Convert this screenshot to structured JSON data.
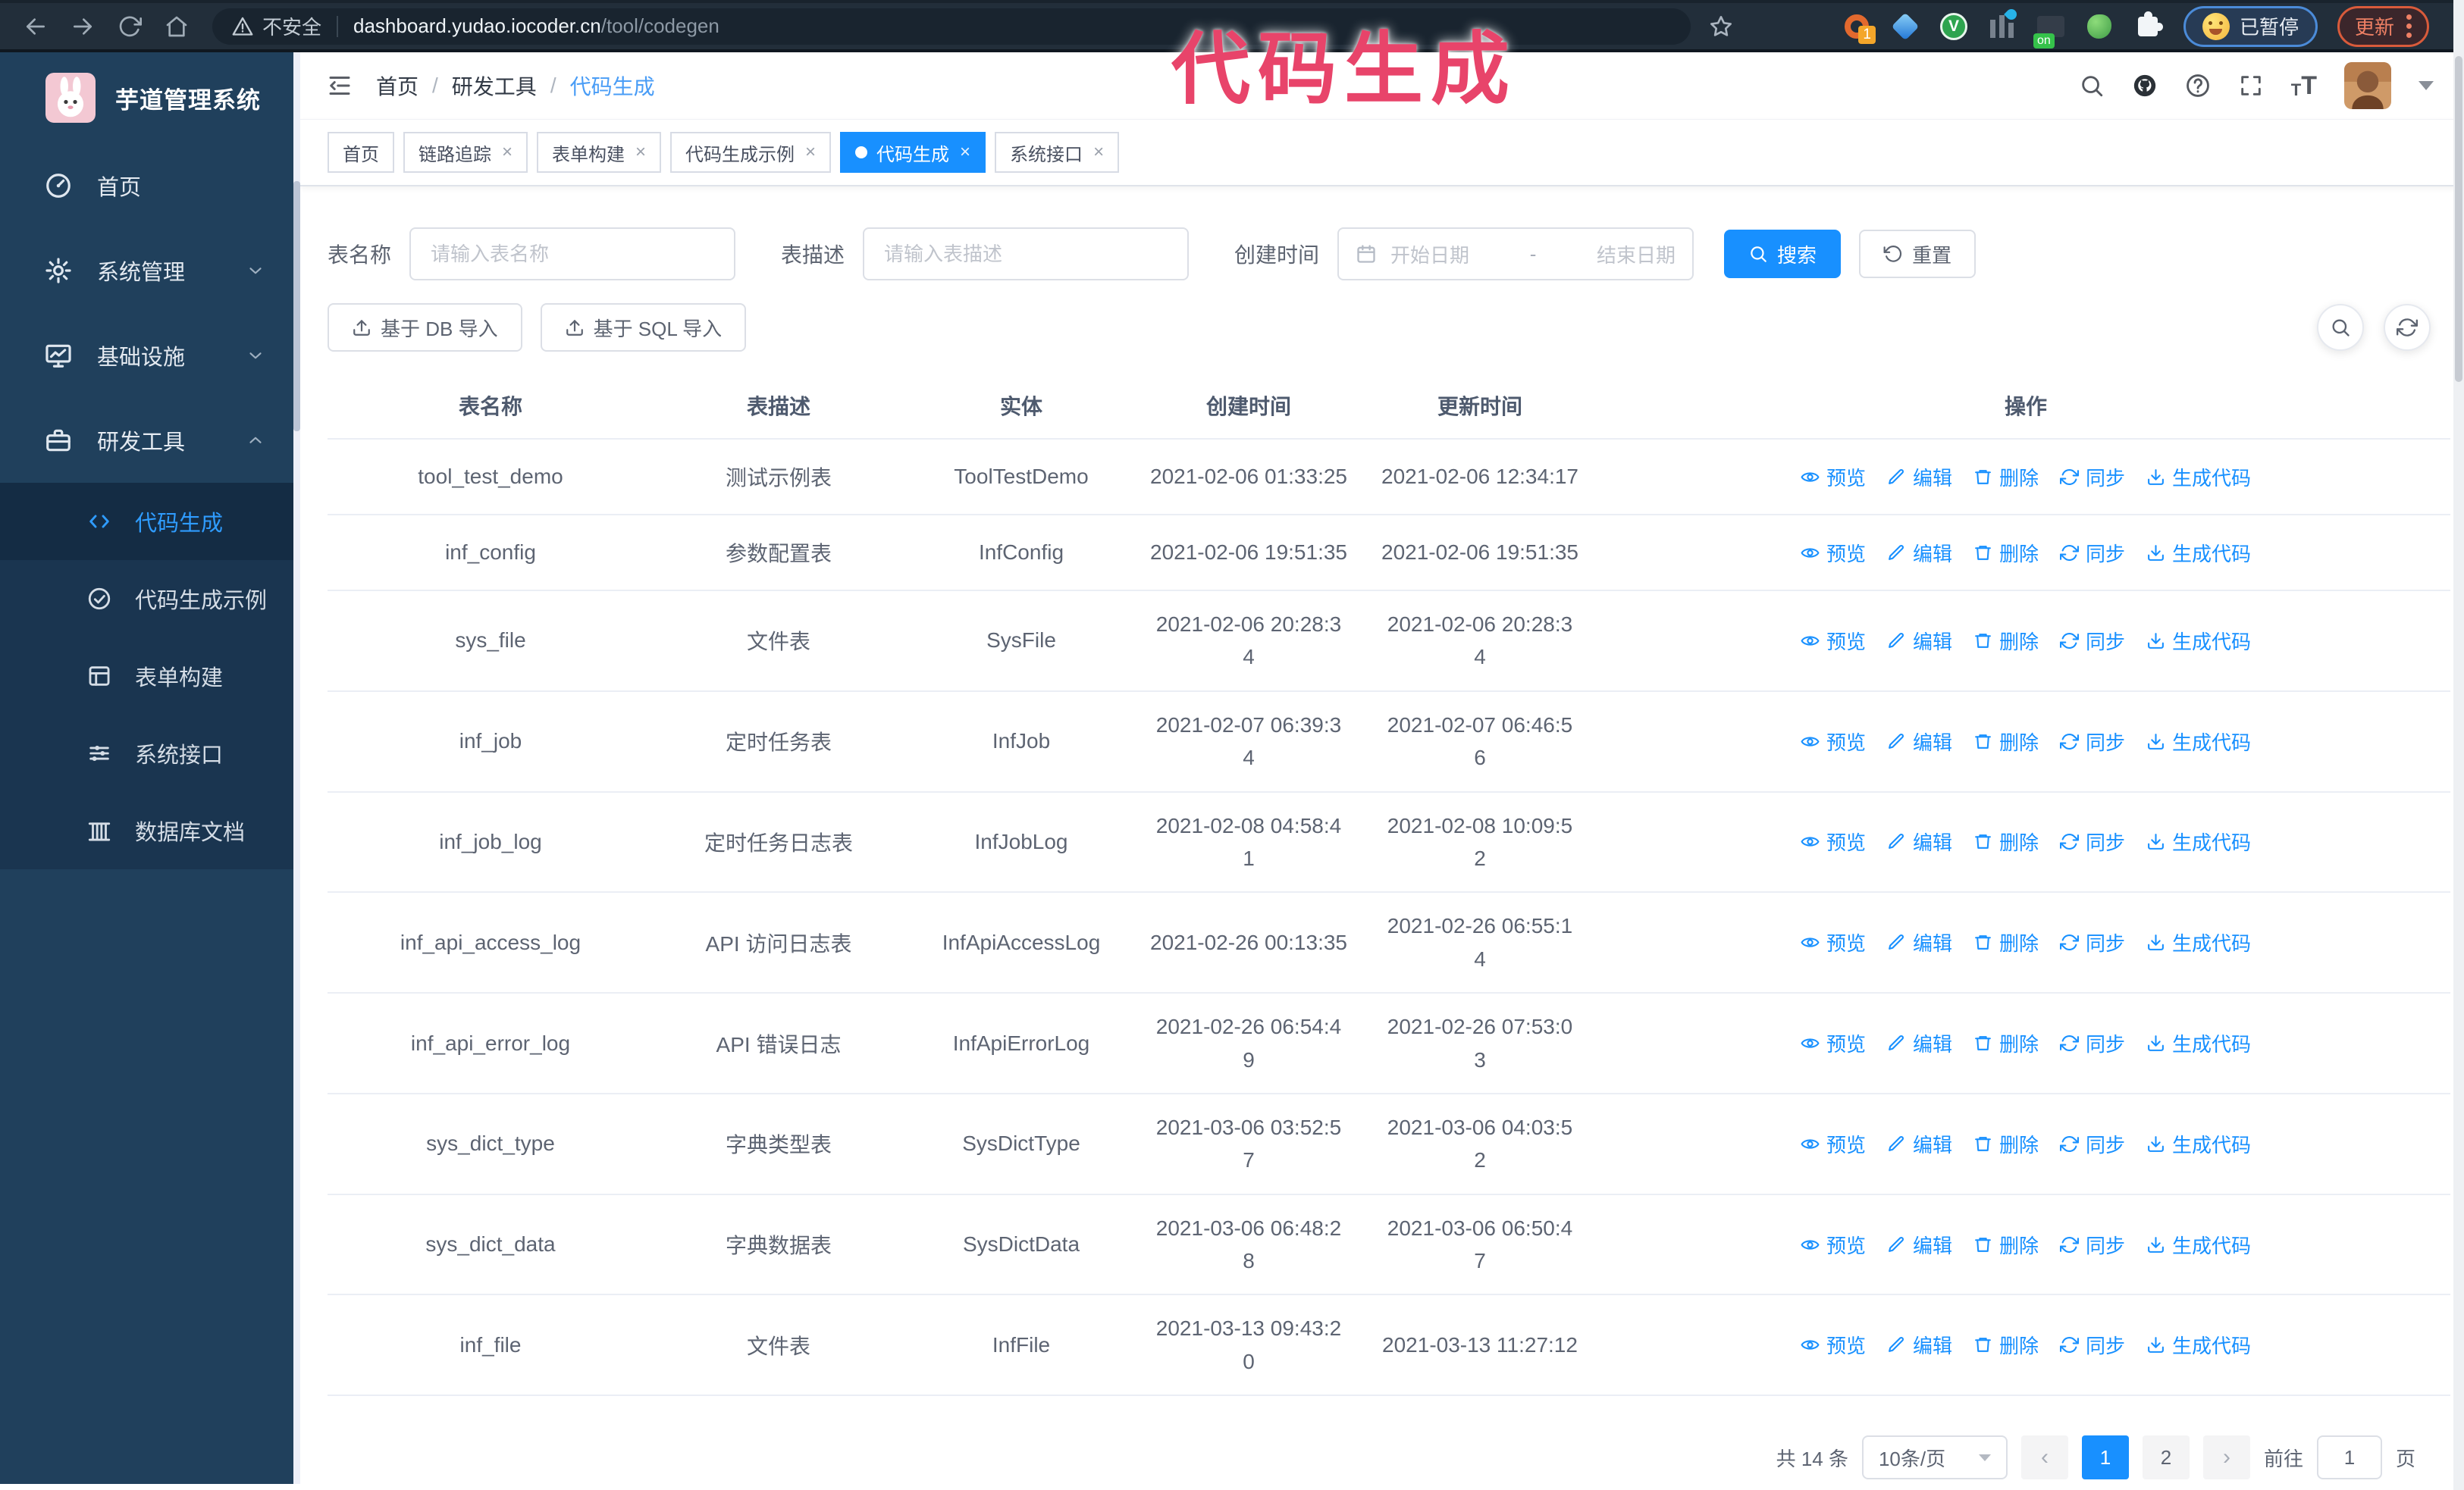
{
  "colors": {
    "primary": "#1890ff",
    "sidebar_bg": "#20405c",
    "submenu_bg": "#1a3550",
    "annotation": "#e8446a"
  },
  "annotation": {
    "text": "代码生成"
  },
  "browser": {
    "security_label": "不安全",
    "url_host": "dashboard.yudao.iocoder.cn",
    "url_path": "/tool/codegen",
    "ext_badge": "1",
    "ext_v_label": "V",
    "ext_on_badge": "on",
    "paused_label": "已暂停",
    "update_label": "更新"
  },
  "sidebar": {
    "title": "芋道管理系统",
    "items": [
      {
        "label": "首页"
      },
      {
        "label": "系统管理"
      },
      {
        "label": "基础设施"
      },
      {
        "label": "研发工具"
      }
    ],
    "dev_children": [
      {
        "label": "代码生成"
      },
      {
        "label": "代码生成示例"
      },
      {
        "label": "表单构建"
      },
      {
        "label": "系统接口"
      },
      {
        "label": "数据库文档"
      }
    ]
  },
  "topbar": {
    "breadcrumb": [
      "首页",
      "研发工具",
      "代码生成"
    ],
    "separator": "/"
  },
  "tabs": [
    {
      "label": "首页"
    },
    {
      "label": "链路追踪"
    },
    {
      "label": "表单构建"
    },
    {
      "label": "代码生成示例"
    },
    {
      "label": "代码生成"
    },
    {
      "label": "系统接口"
    }
  ],
  "ui": {
    "close_glyph": "×",
    "prev_glyph": "‹",
    "next_glyph": "›"
  },
  "search": {
    "name_label": "表名称",
    "name_placeholder": "请输入表名称",
    "desc_label": "表描述",
    "desc_placeholder": "请输入表描述",
    "time_label": "创建时间",
    "start_placeholder": "开始日期",
    "range_separator": "-",
    "end_placeholder": "结束日期",
    "search_label": "搜索",
    "reset_label": "重置"
  },
  "toolbar": {
    "db_import_label": "基于 DB 导入",
    "sql_import_label": "基于 SQL 导入"
  },
  "table": {
    "columns": [
      "表名称",
      "表描述",
      "实体",
      "创建时间",
      "更新时间",
      "操作"
    ],
    "actions": [
      "预览",
      "编辑",
      "删除",
      "同步",
      "生成代码"
    ],
    "rows": [
      {
        "name": "tool_test_demo",
        "desc": "测试示例表",
        "entity": "ToolTestDemo",
        "created": "2021-02-06 01:33:25",
        "updated": "2021-02-06 12:34:17"
      },
      {
        "name": "inf_config",
        "desc": "参数配置表",
        "entity": "InfConfig",
        "created": "2021-02-06 19:51:35",
        "updated": "2021-02-06 19:51:35"
      },
      {
        "name": "sys_file",
        "desc": "文件表",
        "entity": "SysFile",
        "created": "2021-02-06 20:28:3\n4",
        "updated": "2021-02-06 20:28:3\n4"
      },
      {
        "name": "inf_job",
        "desc": "定时任务表",
        "entity": "InfJob",
        "created": "2021-02-07 06:39:3\n4",
        "updated": "2021-02-07 06:46:5\n6"
      },
      {
        "name": "inf_job_log",
        "desc": "定时任务日志表",
        "entity": "InfJobLog",
        "created": "2021-02-08 04:58:4\n1",
        "updated": "2021-02-08 10:09:5\n2"
      },
      {
        "name": "inf_api_access_log",
        "desc": "API 访问日志表",
        "entity": "InfApiAccessLog",
        "created": "2021-02-26 00:13:35",
        "updated": "2021-02-26 06:55:1\n4"
      },
      {
        "name": "inf_api_error_log",
        "desc": "API 错误日志",
        "entity": "InfApiErrorLog",
        "created": "2021-02-26 06:54:4\n9",
        "updated": "2021-02-26 07:53:0\n3"
      },
      {
        "name": "sys_dict_type",
        "desc": "字典类型表",
        "entity": "SysDictType",
        "created": "2021-03-06 03:52:5\n7",
        "updated": "2021-03-06 04:03:5\n2"
      },
      {
        "name": "sys_dict_data",
        "desc": "字典数据表",
        "entity": "SysDictData",
        "created": "2021-03-06 06:48:2\n8",
        "updated": "2021-03-06 06:50:4\n7"
      },
      {
        "name": "inf_file",
        "desc": "文件表",
        "entity": "InfFile",
        "created": "2021-03-13 09:43:2\n0",
        "updated": "2021-03-13 11:27:12"
      }
    ]
  },
  "pagination": {
    "total": "共 14 条",
    "page_size": "10条/页",
    "pages": [
      "1",
      "2"
    ],
    "goto_label": "前往",
    "goto_value": "1",
    "unit_label": "页"
  }
}
